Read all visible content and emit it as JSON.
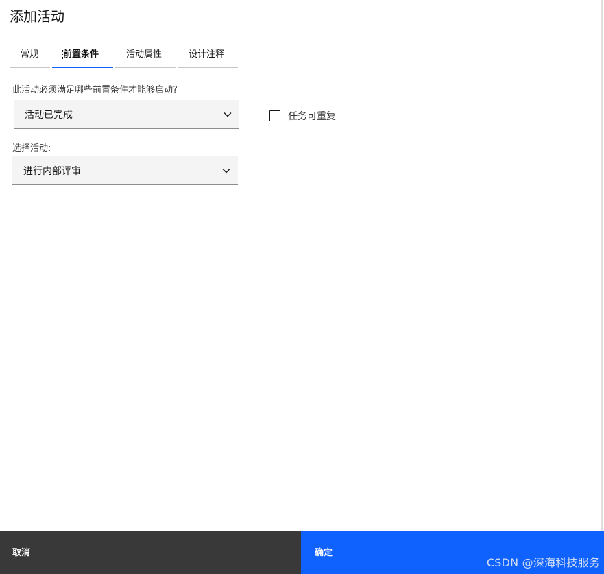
{
  "dialog": {
    "title": "添加活动"
  },
  "tabs": [
    {
      "label": "常规",
      "active": false
    },
    {
      "label": "前置条件",
      "active": true
    },
    {
      "label": "活动属性",
      "active": false
    },
    {
      "label": "设计注释",
      "active": false
    }
  ],
  "conditions": {
    "question": "此活动必须满足哪些前置条件才能够启动?",
    "condition_select_value": "活动已完成",
    "repeatable_label": "任务可重复",
    "repeatable_checked": false,
    "activity_label": "选择活动:",
    "activity_select_value": "进行内部评审"
  },
  "footer": {
    "cancel_label": "取消",
    "ok_label": "确定"
  },
  "watermark": "CSDN @深海科技服务",
  "colors": {
    "primary": "#0f62fe",
    "secondary_button": "#393939",
    "field_background": "#f4f4f4"
  },
  "icons": {
    "select_chevron": "chevron-down-icon"
  }
}
